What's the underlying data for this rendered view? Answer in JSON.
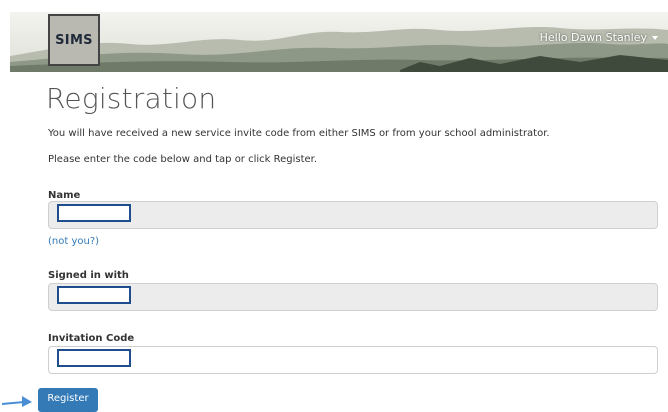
{
  "header": {
    "logo_text": "SIMS",
    "greeting": "Hello Dawn Stanley"
  },
  "page": {
    "title": "Registration",
    "intro_line1": "You will have received a new service invite code from either SIMS or from your school administrator.",
    "intro_line2": "Please enter the code below and tap or click Register."
  },
  "form": {
    "name_label": "Name",
    "name_value": "",
    "not_you_link": "(not you?)",
    "signed_in_label": "Signed in with",
    "signed_in_value": "",
    "invitation_label": "Invitation Code",
    "invitation_value": "",
    "register_label": "Register"
  },
  "colors": {
    "accent": "#337ab7",
    "field_readonly_bg": "#ececec",
    "redaction_border": "#1f4e8c"
  },
  "icons": {
    "user_menu": "chevron-down-icon",
    "annotation_pointer": "arrow-pointer-icon"
  }
}
